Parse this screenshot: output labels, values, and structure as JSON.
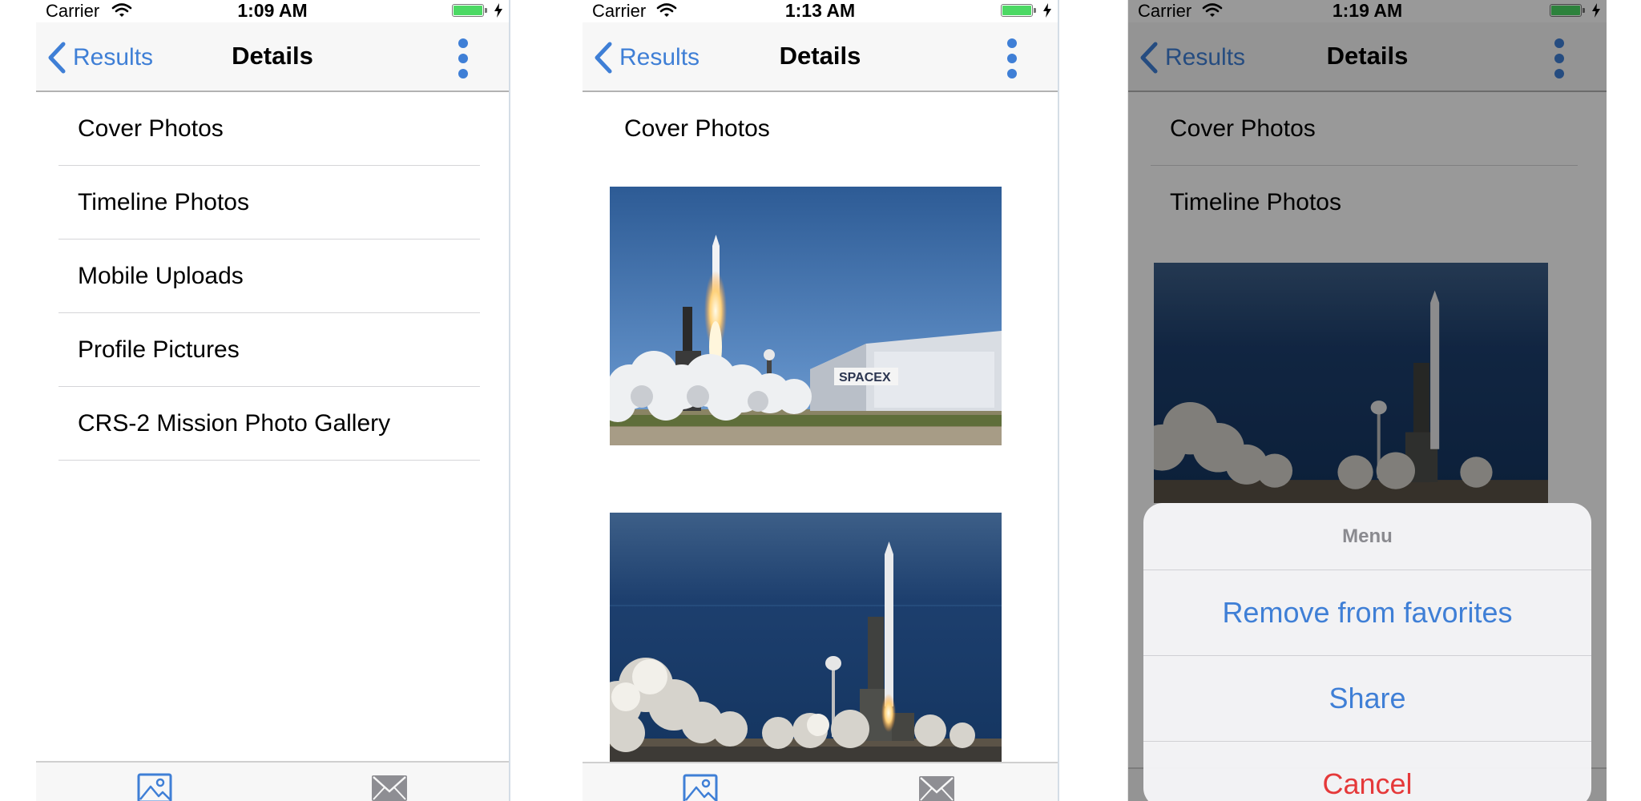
{
  "colors": {
    "accent": "#3f7fd6",
    "destructive": "#e5393a",
    "battery": "#4cd964"
  },
  "screens": [
    {
      "status": {
        "carrier": "Carrier",
        "time": "1:09 AM"
      },
      "nav": {
        "back_label": "Results",
        "title": "Details"
      },
      "rows": [
        "Cover Photos",
        "Timeline Photos",
        "Mobile Uploads",
        "Profile Pictures",
        "CRS-2 Mission Photo Gallery"
      ]
    },
    {
      "status": {
        "carrier": "Carrier",
        "time": "1:13 AM"
      },
      "nav": {
        "back_label": "Results",
        "title": "Details"
      },
      "rows": [
        "Cover Photos"
      ]
    },
    {
      "status": {
        "carrier": "Carrier",
        "time": "1:19 AM"
      },
      "nav": {
        "back_label": "Results",
        "title": "Details"
      },
      "rows": [
        "Cover Photos",
        "Timeline Photos"
      ],
      "action_sheet": {
        "title": "Menu",
        "actions": [
          "Remove from favorites",
          "Share",
          "Cancel"
        ]
      }
    }
  ],
  "icons": {
    "back": "chevron-left-icon",
    "more": "more-vertical-icon",
    "photos_tab": "image-icon",
    "mail_tab": "mail-icon",
    "wifi": "wifi-icon",
    "battery": "battery-icon",
    "charging": "bolt-icon"
  }
}
